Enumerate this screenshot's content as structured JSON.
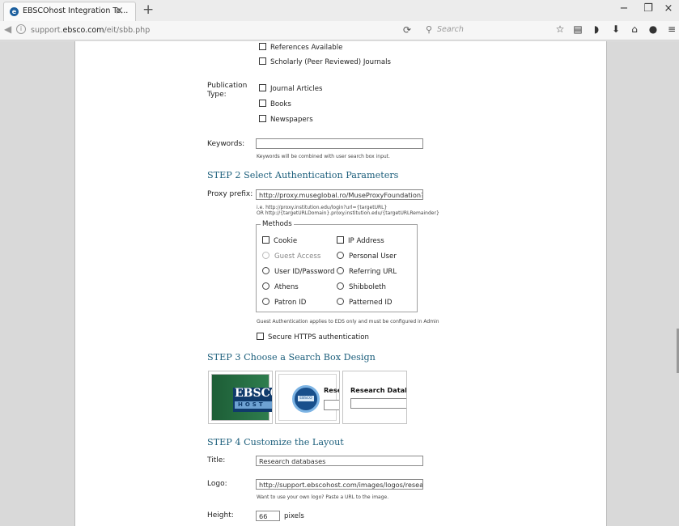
{
  "browser": {
    "tab_title": "EBSCOhost Integration To...",
    "tab_close": "×",
    "new_tab": "+",
    "url_prefix": "support.",
    "url_domain": "ebsco.com",
    "url_path": "/eit/sbb.php",
    "search_placeholder": "Search",
    "window": {
      "minimize": "−",
      "restore": "❐",
      "close": "×"
    }
  },
  "limiters": {
    "references_available": "References Available",
    "scholarly": "Scholarly (Peer Reviewed) Journals"
  },
  "publication_type": {
    "label": "Publication Type:",
    "options": [
      "Journal Articles",
      "Books",
      "Newspapers"
    ]
  },
  "keywords": {
    "label": "Keywords:",
    "value": "",
    "hint": "Keywords will be combined with user search box input."
  },
  "step2": {
    "step": "STEP 2",
    "title": "Select Authentication Parameters",
    "proxy_label": "Proxy prefix:",
    "proxy_value": "http://proxy.museglobal.ro/MuseProxyFoundation?url=",
    "proxy_hint_1": "i.e. http://proxy.institution.edu/login?url={targetURL}",
    "proxy_hint_2": "OR http://{targetURLDomain}.proxy.institution.edu/{targetURLRemainder}",
    "methods_legend": "Methods",
    "methods": {
      "cookie": "Cookie",
      "ip_address": "IP Address",
      "guest_access": "Guest Access",
      "personal_user": "Personal User",
      "user_id_password": "User ID/Password",
      "referring_url": "Referring URL",
      "athens": "Athens",
      "shibboleth": "Shibboleth",
      "patron_id": "Patron ID",
      "patterned_id": "Patterned ID"
    },
    "guest_note": "Guest Authentication applies to EDS only and must be configured in Admin",
    "secure_https": "Secure HTTPS authentication"
  },
  "step3": {
    "step": "STEP 3",
    "title": "Choose a Search Box Design",
    "designs": {
      "ebsco_word": "EBSCO",
      "host_word": "HOST",
      "badge": "EBSCO",
      "second_heading": "Resea",
      "third_heading": "Research Databa"
    }
  },
  "step4": {
    "step": "STEP 4",
    "title": "Customize the Layout",
    "title_label": "Title:",
    "title_value": "Research databases",
    "logo_label": "Logo:",
    "logo_value": "http://support.ebscohost.com/images/logos/researchda",
    "logo_hint": "Want to use your own logo? Paste a URL to the image.",
    "height_label": "Height:",
    "height_value": "66",
    "height_unit": "pixels"
  }
}
